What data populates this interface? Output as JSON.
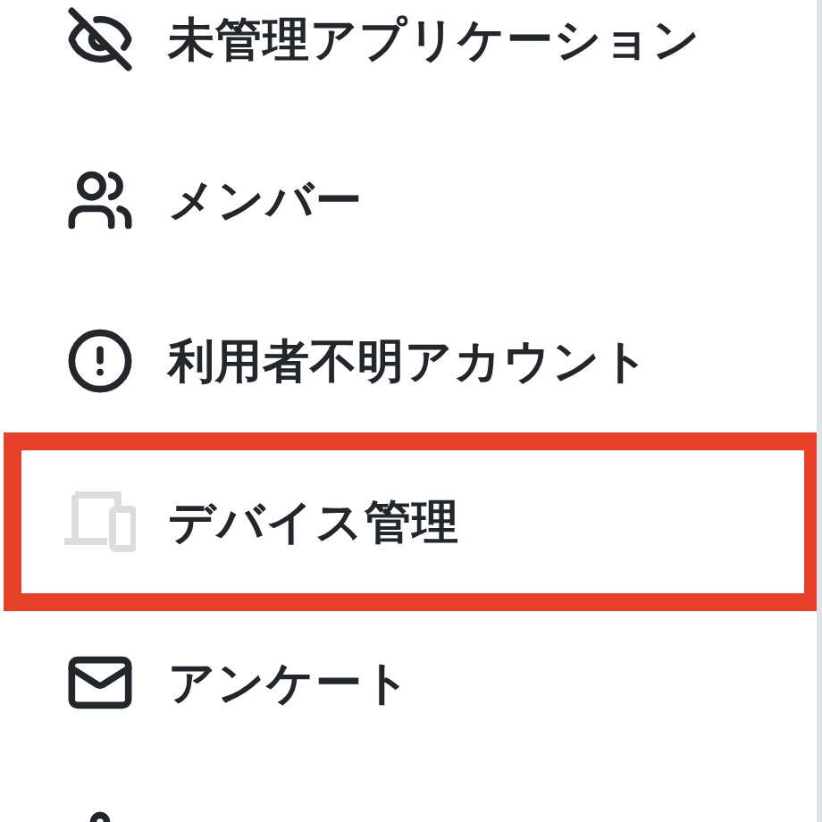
{
  "menu": {
    "items": [
      {
        "label": "未管理アプリケーション",
        "highlighted": false,
        "icon_dimmed": false
      },
      {
        "label": "メンバー",
        "highlighted": false,
        "icon_dimmed": false
      },
      {
        "label": "利用者不明アカウント",
        "highlighted": false,
        "icon_dimmed": false
      },
      {
        "label": "デバイス管理",
        "highlighted": true,
        "icon_dimmed": true
      },
      {
        "label": "アンケート",
        "highlighted": false,
        "icon_dimmed": false
      },
      {
        "highlighted": false,
        "icon_dimmed": false
      }
    ]
  }
}
